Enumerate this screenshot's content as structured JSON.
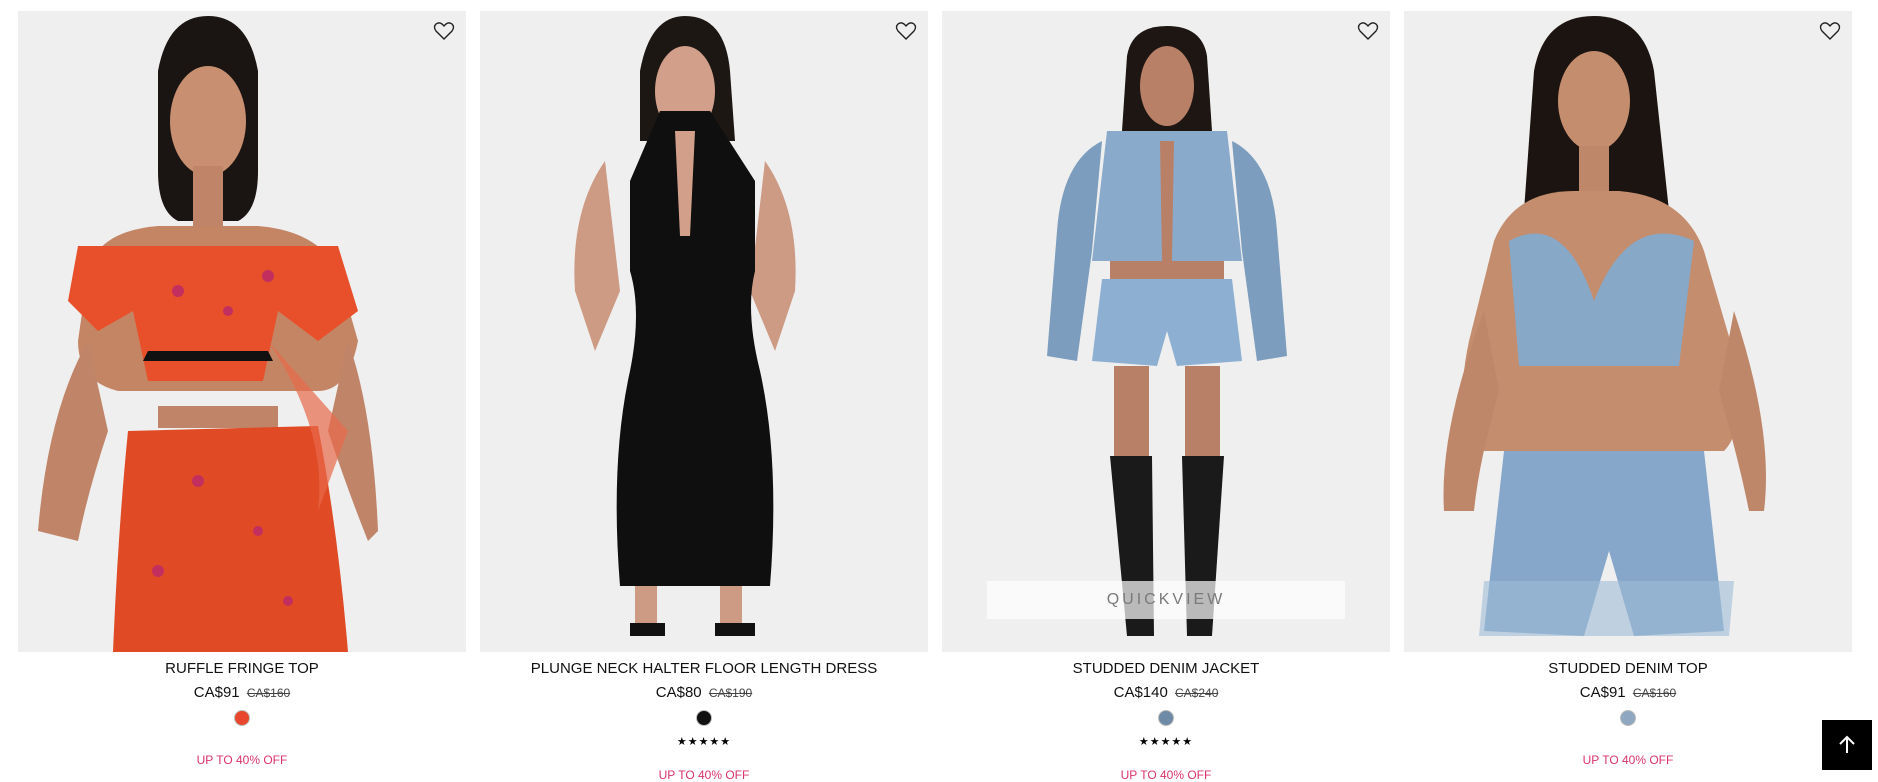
{
  "products": [
    {
      "name": "RUFFLE FRINGE TOP",
      "price": "CA$91",
      "original_price": "CA$160",
      "swatch_color": "#e8472d",
      "rating_stars": "",
      "promo": "UP TO 40% OFF",
      "wishlist_icon": "heart-outline-icon"
    },
    {
      "name": "PLUNGE NECK HALTER FLOOR LENGTH DRESS",
      "price": "CA$80",
      "original_price": "CA$190",
      "swatch_color": "#111111",
      "rating_stars": "★★★★★",
      "promo": "UP TO 40% OFF",
      "wishlist_icon": "heart-outline-icon"
    },
    {
      "name": "STUDDED DENIM JACKET",
      "price": "CA$140",
      "original_price": "CA$240",
      "swatch_color": "#6f8aa6",
      "rating_stars": "★★★★★",
      "promo": "UP TO 40% OFF",
      "quickview": "QUICKVIEW",
      "wishlist_icon": "heart-outline-icon"
    },
    {
      "name": "STUDDED DENIM TOP",
      "price": "CA$91",
      "original_price": "CA$160",
      "swatch_color": "#8fa7c0",
      "rating_stars": "",
      "promo": "UP TO 40% OFF",
      "wishlist_icon": "heart-outline-icon"
    }
  ],
  "back_to_top_icon": "arrow-up-icon"
}
